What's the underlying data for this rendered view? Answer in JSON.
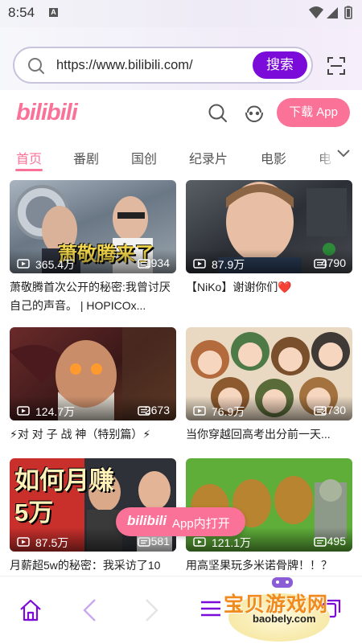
{
  "status_bar": {
    "time": "8:54",
    "notif_letter": "A"
  },
  "browser": {
    "url": "https://www.bilibili.com/",
    "search_label": "搜索"
  },
  "site": {
    "logo": "bilibili",
    "download_label": "下载 App"
  },
  "tabs": [
    {
      "label": "首页",
      "active": true
    },
    {
      "label": "番剧"
    },
    {
      "label": "国创"
    },
    {
      "label": "纪录片"
    },
    {
      "label": "电影"
    },
    {
      "label": "电"
    }
  ],
  "videos": [
    {
      "views": "365.4万",
      "danmaku": "1934",
      "title": "萧敬腾首次公开的秘密:我曾讨厌自己的声音。 | HOPICOx...",
      "overlay": "萧敬腾来了"
    },
    {
      "views": "87.9万",
      "danmaku": "4790",
      "title": "【NiKo】谢谢你们❤️",
      "overlay": ""
    },
    {
      "views": "124.7万",
      "danmaku": "2673",
      "title": "⚡对 对 子 战 神（特别篇）⚡",
      "overlay": ""
    },
    {
      "views": "76.9万",
      "danmaku": "2730",
      "title": "当你穿越回高考出分前一天...",
      "overlay": ""
    },
    {
      "views": "87.5万",
      "danmaku": "581",
      "title": "月薪超5w的秘密：我采访了10",
      "overlay": "如何月赚5万"
    },
    {
      "views": "121.1万",
      "danmaku": "495",
      "title": "用高坚果玩多米诺骨牌！！？",
      "overlay": ""
    }
  ],
  "open_app": {
    "logo": "bilibili",
    "label": "App内打开"
  },
  "watermark": {
    "name": "宝贝游戏网",
    "domain": "baobely.com"
  },
  "colors": {
    "brand_pink": "#fb7299",
    "browser_purple": "#7a0bd8"
  },
  "icons": [
    "search-icon",
    "scan-icon",
    "user-icon",
    "chevron-down-icon",
    "play-icon",
    "danmaku-icon",
    "home-icon",
    "back-icon",
    "forward-icon",
    "menu-icon",
    "tabs-icon"
  ]
}
